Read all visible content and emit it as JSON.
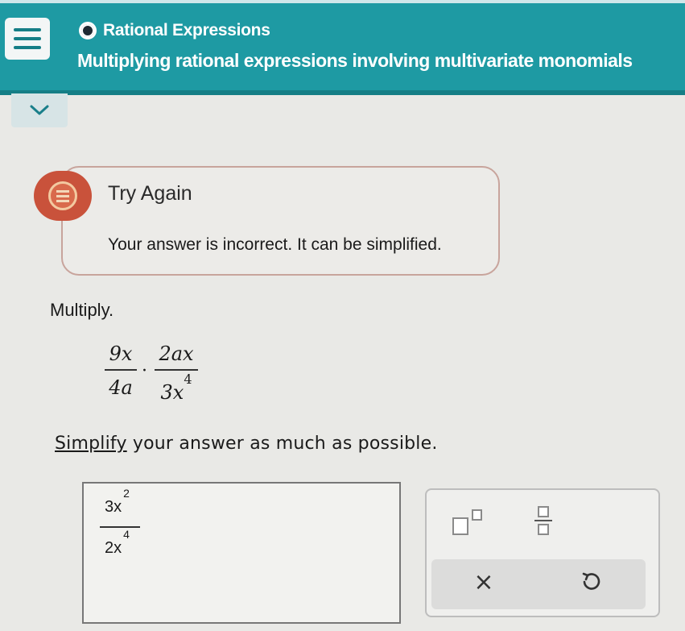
{
  "header": {
    "topic": "Rational Expressions",
    "title": "Multiplying rational expressions involving multivariate monomials",
    "accent_color": "#1e9aa3"
  },
  "feedback": {
    "title": "Try Again",
    "message": "Your answer is incorrect. It can be simplified.",
    "icon": "feedback-icon"
  },
  "problem": {
    "instruction": "Multiply.",
    "fraction1": {
      "numerator": "9x",
      "denominator": "4a"
    },
    "operator": "·",
    "fraction2": {
      "numerator": "2ax",
      "denominator_base": "3x",
      "denominator_exp": "4"
    },
    "simplify_link": "Simplify",
    "simplify_rest": " your answer as much as possible."
  },
  "answer": {
    "numerator_base": "3x",
    "numerator_exp": "2",
    "denominator_base": "2x",
    "denominator_exp": "4"
  },
  "tools": {
    "exponent_icon": "exponent-template-icon",
    "fraction_icon": "fraction-template-icon",
    "clear_label": "×",
    "undo_icon": "undo-icon"
  }
}
